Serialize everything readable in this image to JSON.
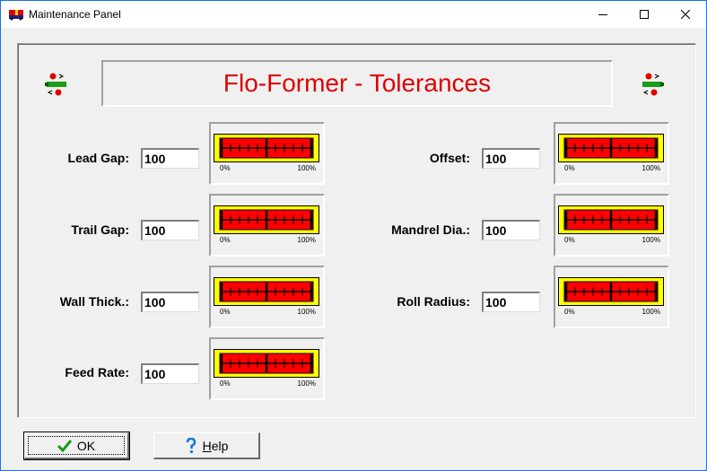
{
  "window": {
    "title": "Maintenance Panel"
  },
  "banner": {
    "title": "Flo-Former - Tolerances"
  },
  "fields": {
    "lead_gap": {
      "label": "Lead Gap:",
      "value": "100"
    },
    "trail_gap": {
      "label": "Trail Gap:",
      "value": "100"
    },
    "wall_thick": {
      "label": "Wall Thick.:",
      "value": "100"
    },
    "feed_rate": {
      "label": "Feed Rate:",
      "value": "100"
    },
    "offset": {
      "label": "Offset:",
      "value": "100"
    },
    "mandrel_dia": {
      "label": "Mandrel Dia.:",
      "value": "100"
    },
    "roll_radius": {
      "label": "Roll Radius:",
      "value": "100"
    }
  },
  "gauge": {
    "min_label": "0%",
    "max_label": "100%",
    "level_percent": 100
  },
  "buttons": {
    "ok_label": "OK",
    "help_label": "Help"
  },
  "colors": {
    "banner_text": "#e00000",
    "gauge_outer": "#ffff00",
    "gauge_fill": "#ff0000",
    "accent": "#1a73d9"
  }
}
